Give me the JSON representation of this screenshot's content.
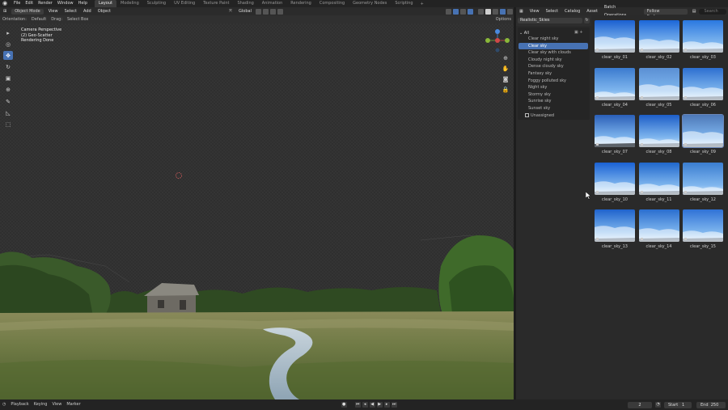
{
  "topbar": {
    "menus": [
      "File",
      "Edit",
      "Render",
      "Window",
      "Help"
    ],
    "workspaces": [
      "Layout",
      "Modeling",
      "Sculpting",
      "UV Editing",
      "Texture Paint",
      "Shading",
      "Animation",
      "Rendering",
      "Compositing",
      "Geometry Nodes",
      "Scripting"
    ],
    "active_workspace": "Layout",
    "add_label": "+"
  },
  "viewport_header": {
    "mode": "Object Mode",
    "menus": [
      "View",
      "Select",
      "Add",
      "Object"
    ],
    "transform_orientation": "Global"
  },
  "tool_settings": {
    "orientation_label": "Orientation:",
    "orientation_value": "Default",
    "drag_label": "Drag:",
    "drag_value": "Select Box",
    "options_label": "Options"
  },
  "viewport_overlay": {
    "line1": "Camera Perspective",
    "line2": "(2) Geo-Scatter",
    "line3": "Rendering Done"
  },
  "toolbar_tools": [
    {
      "name": "select-box-tool",
      "glyph": "▸"
    },
    {
      "name": "cursor-tool",
      "glyph": "◎"
    },
    {
      "name": "move-tool",
      "glyph": "✥"
    },
    {
      "name": "rotate-tool",
      "glyph": "↻"
    },
    {
      "name": "scale-tool",
      "glyph": "▣"
    },
    {
      "name": "transform-tool",
      "glyph": "⊕"
    },
    {
      "name": "annotate-tool",
      "glyph": "✎"
    },
    {
      "name": "measure-tool",
      "glyph": "◺"
    },
    {
      "name": "add-cube-tool",
      "glyph": "⬚"
    }
  ],
  "asset_header": {
    "menus": [
      "View",
      "Select",
      "Catalog",
      "Asset",
      "Batch Operations"
    ],
    "preferences": "Follow Preferences",
    "search_placeholder": "Search"
  },
  "library": {
    "name": "Realistic_Skies"
  },
  "catalog": {
    "root": "All",
    "items": [
      "Clear night sky",
      "Clear sky",
      "Clear sky with clouds",
      "Cloudy night sky",
      "Dense cloudy sky",
      "Fantasy sky",
      "Foggy polluted sky",
      "Night sky",
      "Stormy sky",
      "Sunrise sky",
      "Sunset sky"
    ],
    "selected_index": 1,
    "unassigned": "Unassigned"
  },
  "assets": [
    "clear_sky_01",
    "clear_sky_02",
    "clear_sky_03",
    "clear_sky_04",
    "clear_sky_05",
    "clear_sky_06",
    "clear_sky_07",
    "clear_sky_08",
    "clear_sky_09",
    "clear_sky_10",
    "clear_sky_11",
    "clear_sky_12",
    "clear_sky_13",
    "clear_sky_14",
    "clear_sky_15"
  ],
  "selected_asset_index": 8,
  "timeline": {
    "menus": [
      "Playback",
      "Keying",
      "View",
      "Marker"
    ],
    "current_frame": "2",
    "start_label": "Start",
    "start_value": "1",
    "end_label": "End",
    "end_value": "250"
  },
  "colors": {
    "accent": "#4772b3",
    "background": "#1d1d1d",
    "panel": "#2a2a2a"
  }
}
